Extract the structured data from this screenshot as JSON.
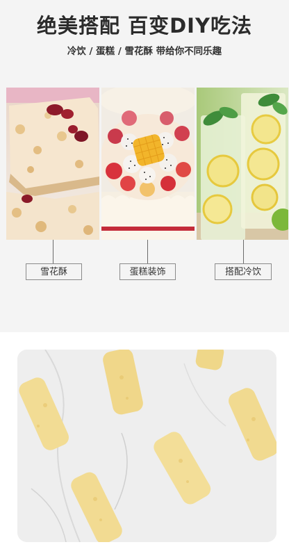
{
  "headline": "绝美搭配 百变DIY吃法",
  "subline": "冷饮 / 蛋糕 / 雪花酥 带给你不同乐趣",
  "uses": [
    {
      "label": "雪花酥"
    },
    {
      "label": "蛋糕装饰"
    },
    {
      "label": "搭配冷饮"
    }
  ],
  "colors": {
    "panel_background": "#f4f4f4",
    "headline_text": "#2b2b2b",
    "fruit_yellow": "#f2d57a"
  }
}
